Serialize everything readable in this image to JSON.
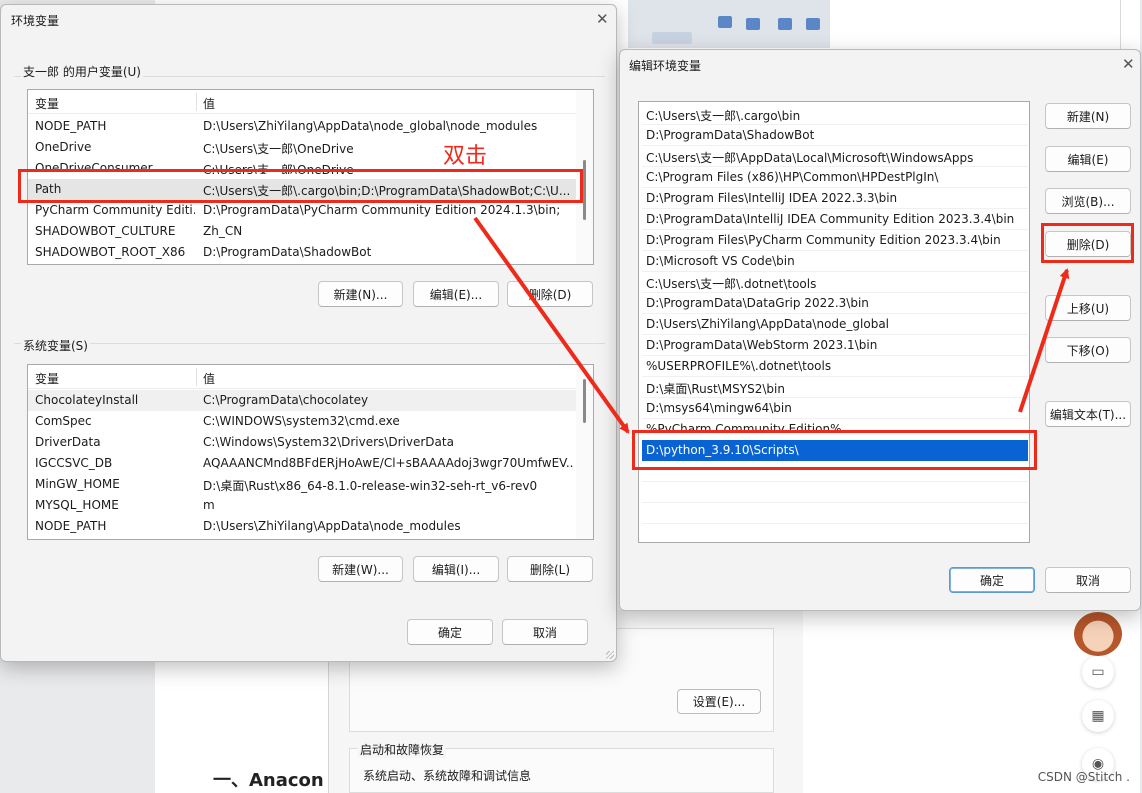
{
  "background": {
    "heading": "一、Anacon",
    "settings_button": "设置(E)...",
    "startup_title": "启动和故障恢复",
    "startup_desc": "系统启动、系统故障和调试信息",
    "watermark": "CSDN @Stitch ."
  },
  "env_window": {
    "title": "环境变量",
    "user_section_label": "支一郎 的用户变量(U)",
    "system_section_label": "系统变量(S)",
    "columns": [
      "变量",
      "值"
    ],
    "user_vars": [
      {
        "name": "NODE_PATH",
        "value": "D:\\Users\\ZhiYilang\\AppData\\node_global\\node_modules"
      },
      {
        "name": "OneDrive",
        "value": "C:\\Users\\支一郎\\OneDrive"
      },
      {
        "name": "OneDriveConsumer",
        "value": "C:\\Users\\支一郎\\OneDrive"
      },
      {
        "name": "Path",
        "value": "C:\\Users\\支一郎\\.cargo\\bin;D:\\ProgramData\\ShadowBot;C:\\U..."
      },
      {
        "name": "PyCharm Community Editi...",
        "value": "D:\\ProgramData\\PyCharm Community Edition 2024.1.3\\bin;"
      },
      {
        "name": "SHADOWBOT_CULTURE",
        "value": "Zh_CN"
      },
      {
        "name": "SHADOWBOT_ROOT_X86",
        "value": "D:\\ProgramData\\ShadowBot"
      }
    ],
    "user_buttons": {
      "new": "新建(N)...",
      "edit": "编辑(E)...",
      "delete": "删除(D)"
    },
    "system_vars": [
      {
        "name": "ChocolateyInstall",
        "value": "C:\\ProgramData\\chocolatey"
      },
      {
        "name": "ComSpec",
        "value": "C:\\WINDOWS\\system32\\cmd.exe"
      },
      {
        "name": "DriverData",
        "value": "C:\\Windows\\System32\\Drivers\\DriverData"
      },
      {
        "name": "IGCCSVC_DB",
        "value": "AQAAANCMnd8BFdERjHoAwE/Cl+sBAAAAdoj3wgr70UmfwEV..."
      },
      {
        "name": "MinGW_HOME",
        "value": "D:\\桌面\\Rust\\x86_64-8.1.0-release-win32-seh-rt_v6-rev0"
      },
      {
        "name": "MYSQL_HOME",
        "value": "m"
      },
      {
        "name": "NODE_PATH",
        "value": "D:\\Users\\ZhiYilang\\AppData\\node_modules"
      }
    ],
    "system_buttons": {
      "new": "新建(W)...",
      "edit": "编辑(I)...",
      "delete": "删除(L)"
    },
    "ok": "确定",
    "cancel": "取消"
  },
  "edit_window": {
    "title": "编辑环境变量",
    "paths": [
      "C:\\Users\\支一郎\\.cargo\\bin",
      "D:\\ProgramData\\ShadowBot",
      "C:\\Users\\支一郎\\AppData\\Local\\Microsoft\\WindowsApps",
      "C:\\Program Files (x86)\\HP\\Common\\HPDestPlgIn\\",
      "D:\\Program Files\\IntelliJ IDEA 2022.3.3\\bin",
      "D:\\ProgramData\\IntelliJ IDEA Community Edition 2023.3.4\\bin",
      "D:\\Program Files\\PyCharm Community Edition 2023.3.4\\bin",
      "D:\\Microsoft VS Code\\bin",
      "C:\\Users\\支一郎\\.dotnet\\tools",
      "D:\\ProgramData\\DataGrip 2022.3\\bin",
      "D:\\Users\\ZhiYilang\\AppData\\node_global",
      "D:\\ProgramData\\WebStorm 2023.1\\bin",
      "%USERPROFILE%\\.dotnet\\tools",
      "D:\\桌面\\Rust\\MSYS2\\bin",
      "D:\\msys64\\mingw64\\bin",
      "%PyCharm Community Edition%",
      "D:\\python_3.9.10\\Scripts\\"
    ],
    "buttons": {
      "new": "新建(N)",
      "edit": "编辑(E)",
      "browse": "浏览(B)...",
      "delete": "删除(D)",
      "move_up": "上移(U)",
      "move_down": "下移(O)",
      "edit_text": "编辑文本(T)..."
    },
    "ok": "确定",
    "cancel": "取消"
  },
  "annotation": {
    "double_click": "双击",
    "color": "#ee2a1b"
  }
}
